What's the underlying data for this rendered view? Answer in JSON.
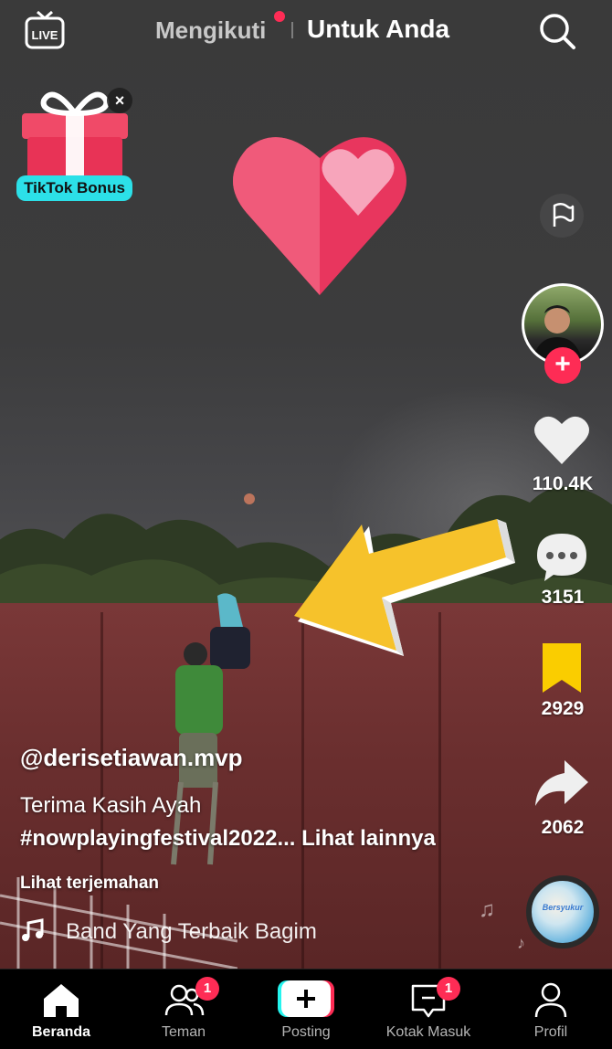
{
  "top_bar": {
    "live_label": "LIVE",
    "tab_following": "Mengikuti",
    "tab_for_you": "Untuk Anda",
    "active_tab": "Untuk Anda"
  },
  "bonus": {
    "label": "TikTok Bonus",
    "close_glyph": "×"
  },
  "right_rail": {
    "follow_glyph": "+",
    "likes": "110.4K",
    "comments": "3151",
    "saves": "2929",
    "shares": "2062",
    "disc_label": "Bersyukur"
  },
  "caption": {
    "username": "@derisetiawan.mvp",
    "text": "Terima Kasih Ayah",
    "hashtags": "#nowplayingfestival2022...",
    "see_more": "Lihat lainnya",
    "translate": "Lihat terjemahan",
    "music": "Band   Yang Terbaik Bagim"
  },
  "bottom_nav": {
    "items": [
      {
        "label": "Beranda",
        "icon": "home-icon",
        "active": true
      },
      {
        "label": "Teman",
        "icon": "friends-icon",
        "badge": "1"
      },
      {
        "label": "Posting",
        "icon": "post-icon"
      },
      {
        "label": "Kotak Masuk",
        "icon": "inbox-icon",
        "badge": "1"
      },
      {
        "label": "Profil",
        "icon": "profile-icon"
      }
    ]
  },
  "colors": {
    "accent_red": "#fe2c55",
    "accent_cyan": "#25f4ee",
    "save_yellow": "#facd00"
  }
}
